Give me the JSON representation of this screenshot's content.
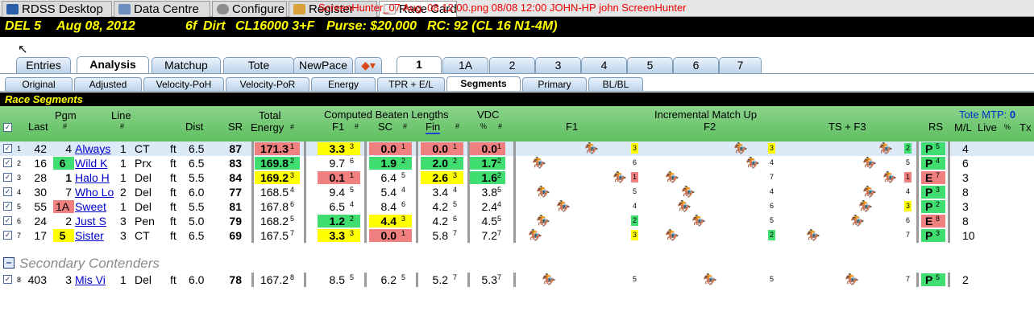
{
  "app_tabs": [
    {
      "label": "RDSS Desktop",
      "active": false
    },
    {
      "label": "Data Centre",
      "active": false
    },
    {
      "label": "Configure",
      "active": false
    },
    {
      "label": "Register",
      "active": false
    },
    {
      "label": "Race Card",
      "active": true
    }
  ],
  "screenhunter": "ScreenHunter_07 Aug. 08 12.00.png  08/08  12:00  JOHN-HP  john  ScreenHunter",
  "race": {
    "num": "DEL  5",
    "date": "Aug 08, 2012",
    "dist": "6f",
    "surface": "Dirt",
    "cond": "CL16000  3+F",
    "purse": "Purse: $20,000",
    "rc": "RC: 92  (CL 16 N1-4M)"
  },
  "main_tabs": [
    "Entries",
    "Analysis",
    "Matchup",
    "Tote",
    "NewPace"
  ],
  "num_tabs": [
    "1",
    "1A",
    "2",
    "3",
    "4",
    "5",
    "6",
    "7"
  ],
  "sub_tabs": [
    "Original",
    "Adjusted",
    "Velocity-PoH",
    "Velocity-PoR",
    "Energy",
    "TPR + E/L",
    "Segments",
    "Primary",
    "BL/BL"
  ],
  "section_title": "Race Segments",
  "headers": {
    "last": "Last",
    "pgm": "Pgm",
    "line": "Line",
    "dist": "Dist",
    "sr": "SR",
    "total": "Total",
    "energy": "Energy",
    "cbl": "Computed Beaten Lengths",
    "f1": "F1",
    "sc": "SC",
    "fin": "Fin",
    "vdc": "VDC",
    "pct": "%",
    "hash": "#",
    "imu": "Incremental Match Up",
    "imu_f1": "F1",
    "imu_f2": "F2",
    "imu_ts": "TS + F3",
    "rs": "RS",
    "tote": "Tote MTP:",
    "mtp": "0",
    "ml": "M/L",
    "live": "Live",
    "tx": "Tx"
  },
  "rows": [
    {
      "n": "1",
      "last": "42",
      "pgm": "4",
      "name": "Always",
      "line": "1",
      "trk": "CT",
      "surf": "ft",
      "dist": "6.5",
      "sr": "87",
      "en": "171.3",
      "enr": "1",
      "f1": "3.3",
      "f1r": "3",
      "sc": "0.0",
      "scr": "1",
      "fin": "0.0",
      "finr": "1",
      "vdc": "0.0",
      "vdcr": "1",
      "b1": "3",
      "b2": "3",
      "b3": "2",
      "rs": "P",
      "rsr": "5",
      "ml": "4"
    },
    {
      "n": "2",
      "last": "16",
      "pgm": "6",
      "name": "Wild K",
      "line": "1",
      "trk": "Prx",
      "surf": "ft",
      "dist": "6.5",
      "sr": "83",
      "en": "169.8",
      "enr": "2",
      "f1": "9.7",
      "f1r": "6",
      "sc": "1.9",
      "scr": "2",
      "fin": "2.0",
      "finr": "2",
      "vdc": "1.7",
      "vdcr": "2",
      "b1": "6",
      "b2": "4",
      "b3": "5",
      "rs": "P",
      "rsr": "4",
      "ml": "6"
    },
    {
      "n": "3",
      "last": "28",
      "pgm": "1",
      "name": "Halo H",
      "line": "1",
      "trk": "Del",
      "surf": "ft",
      "dist": "5.5",
      "sr": "84",
      "en": "169.2",
      "enr": "3",
      "f1": "0.1",
      "f1r": "1",
      "sc": "6.4",
      "scr": "5",
      "fin": "2.6",
      "finr": "3",
      "vdc": "1.6",
      "vdcr": "2",
      "b1": "1",
      "b2": "7",
      "b3": "1",
      "rs": "E",
      "rsr": "7",
      "ml": "3"
    },
    {
      "n": "4",
      "last": "30",
      "pgm": "7",
      "name": "Who Lo",
      "line": "2",
      "trk": "Del",
      "surf": "ft",
      "dist": "6.0",
      "sr": "77",
      "en": "168.5",
      "enr": "4",
      "f1": "9.4",
      "f1r": "5",
      "sc": "5.4",
      "scr": "4",
      "fin": "3.4",
      "finr": "4",
      "vdc": "3.8",
      "vdcr": "5",
      "b1": "5",
      "b2": "4",
      "b3": "4",
      "rs": "P",
      "rsr": "3",
      "ml": "8"
    },
    {
      "n": "5",
      "last": "55",
      "pgm": "1A",
      "name": "Sweet",
      "line": "1",
      "trk": "Del",
      "surf": "ft",
      "dist": "5.5",
      "sr": "81",
      "en": "167.8",
      "enr": "6",
      "f1": "6.5",
      "f1r": "4",
      "sc": "8.4",
      "scr": "6",
      "fin": "4.2",
      "finr": "5",
      "vdc": "2.4",
      "vdcr": "4",
      "b1": "4",
      "b2": "6",
      "b3": "3",
      "rs": "P",
      "rsr": "2",
      "ml": "3"
    },
    {
      "n": "6",
      "last": "24",
      "pgm": "2",
      "name": "Just S",
      "line": "3",
      "trk": "Pen",
      "surf": "ft",
      "dist": "5.0",
      "sr": "79",
      "en": "168.2",
      "enr": "5",
      "f1": "1.2",
      "f1r": "2",
      "sc": "4.4",
      "scr": "3",
      "fin": "4.2",
      "finr": "6",
      "vdc": "4.5",
      "vdcr": "5",
      "b1": "2",
      "b2": "5",
      "b3": "6",
      "rs": "E",
      "rsr": "8",
      "ml": "8"
    },
    {
      "n": "7",
      "last": "17",
      "pgm": "5",
      "name": "Sister",
      "line": "3",
      "trk": "CT",
      "surf": "ft",
      "dist": "6.5",
      "sr": "69",
      "en": "167.5",
      "enr": "7",
      "f1": "3.3",
      "f1r": "3",
      "sc": "0.0",
      "scr": "1",
      "fin": "5.8",
      "finr": "7",
      "vdc": "7.2",
      "vdcr": "7",
      "b1": "3",
      "b2": "2",
      "b3": "7",
      "rs": "P",
      "rsr": "3",
      "ml": "10"
    }
  ],
  "secondary_title": "Secondary Contenders",
  "secondary": {
    "n": "8",
    "last": "403",
    "pgm": "3",
    "name": "Mis Vi",
    "line": "1",
    "trk": "Del",
    "surf": "ft",
    "dist": "6.0",
    "sr": "78",
    "en": "167.2",
    "enr": "8",
    "f1": "8.5",
    "f1r": "5",
    "sc": "6.2",
    "scr": "5",
    "fin": "5.2",
    "finr": "7",
    "vdc": "5.3",
    "vdcr": "7",
    "b1": "5",
    "b2": "5",
    "b3": "7",
    "rs": "P",
    "rsr": "5",
    "ml": "2"
  }
}
